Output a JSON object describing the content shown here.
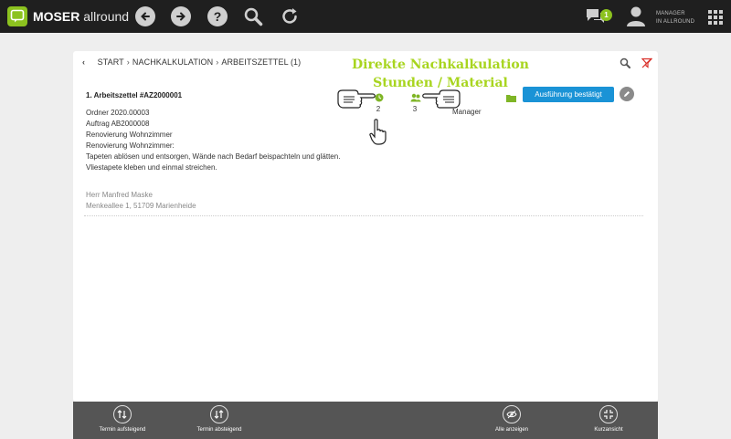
{
  "app": {
    "brand_bold": "MOSER",
    "brand_rest": "allround"
  },
  "topbar": {
    "icons": [
      "back-icon",
      "forward-icon",
      "help-icon",
      "search-icon",
      "refresh-icon"
    ],
    "chat_badge": "1",
    "user_label_line1": "MANAGER",
    "user_label_line2": "IN ALLROUND",
    "accent": "#8cc21f"
  },
  "breadcrumb": {
    "items": [
      "START",
      "NACHKALKULATION",
      "ARBEITSZETTEL"
    ],
    "count": "(1)"
  },
  "overlay": {
    "line1": "Direkte Nachkalkulation",
    "line2": "Stunden / Material",
    "color": "#a8d51f"
  },
  "entry": {
    "title": "1. Arbeitszettel #AZ2000001",
    "details": [
      "Ordner 2020.00003",
      "Auftrag AB2000008",
      "Renovierung Wohnzimmer",
      "Renovierung Wohnzimmer:",
      "Tapeten ablösen und entsorgen, Wände nach Bedarf beispachteln und glätten.",
      "Vliestapete kleben und einmal streichen."
    ],
    "contact_name": "Herr Manfred Maske",
    "contact_address": "Menkeallee 1, 51709 Marienheide",
    "hours_count": "2",
    "material_count": "3",
    "role": "Manager",
    "action_label": "Ausführung bestätigt",
    "action_color": "#1a93d6"
  },
  "bottombar": {
    "buttons": [
      {
        "label": "Termin aufsteigend",
        "icon": "sort-ascending-icon"
      },
      {
        "label": "Termin absteigend",
        "icon": "sort-descending-icon"
      },
      {
        "label": "Alle anzeigen",
        "icon": "eye-icon"
      },
      {
        "label": "Kurzansicht",
        "icon": "compress-icon"
      }
    ]
  }
}
